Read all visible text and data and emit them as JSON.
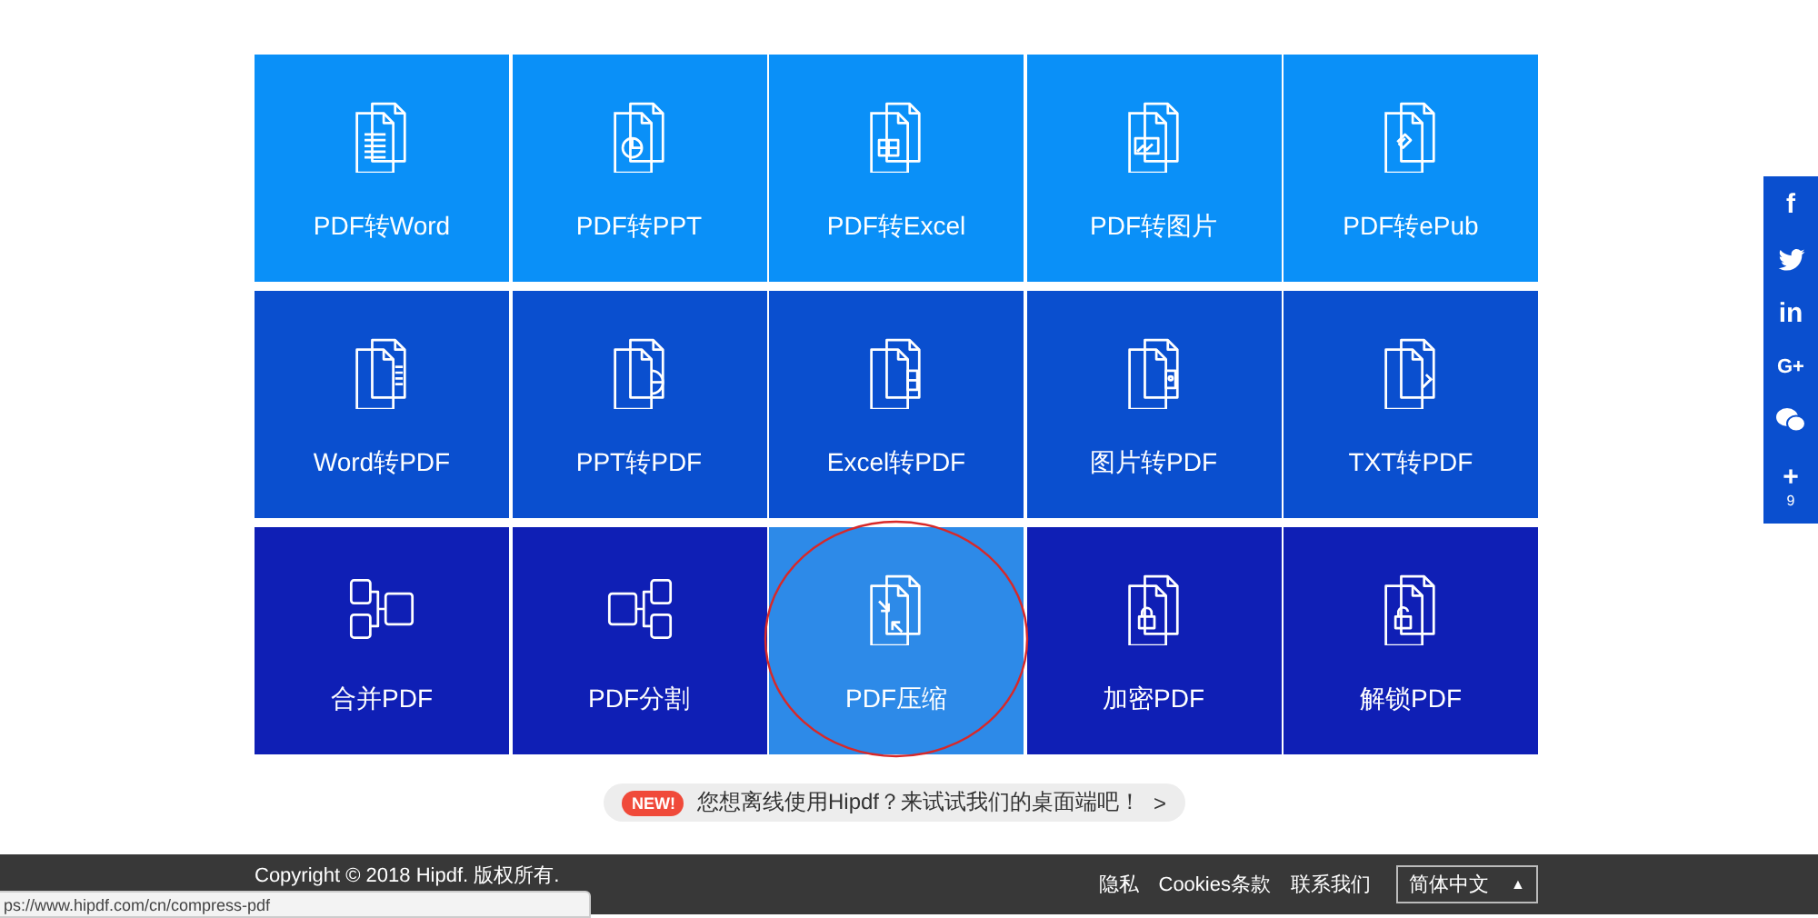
{
  "tools": [
    {
      "label": "PDF转Word",
      "kind": "doc-lines",
      "color": "#0a90f8",
      "circled": false
    },
    {
      "label": "PDF转PPT",
      "kind": "doc-pie",
      "color": "#0a90f8",
      "circled": false
    },
    {
      "label": "PDF转Excel",
      "kind": "doc-grid",
      "color": "#0a90f8",
      "circled": false
    },
    {
      "label": "PDF转图片",
      "kind": "doc-image",
      "color": "#0a90f8",
      "circled": false
    },
    {
      "label": "PDF转ePub",
      "kind": "doc-epub",
      "color": "#0a90f8",
      "circled": false
    },
    {
      "label": "Word转PDF",
      "kind": "to-lines",
      "color": "#0a4fcf",
      "circled": false
    },
    {
      "label": "PPT转PDF",
      "kind": "to-pie",
      "color": "#0a4fcf",
      "circled": false
    },
    {
      "label": "Excel转PDF",
      "kind": "to-grid",
      "color": "#0a4fcf",
      "circled": false
    },
    {
      "label": "图片转PDF",
      "kind": "to-image",
      "color": "#0a4fcf",
      "circled": false
    },
    {
      "label": "TXT转PDF",
      "kind": "to-pen",
      "color": "#0a4fcf",
      "circled": false
    },
    {
      "label": "合并PDF",
      "kind": "merge",
      "color": "#0f1fb5",
      "circled": false
    },
    {
      "label": "PDF分割",
      "kind": "split",
      "color": "#0f1fb5",
      "circled": false
    },
    {
      "label": "PDF压缩",
      "kind": "compress",
      "color": "#2d8ae8",
      "circled": true
    },
    {
      "label": "加密PDF",
      "kind": "lock",
      "color": "#0f1fb5",
      "circled": false
    },
    {
      "label": "解锁PDF",
      "kind": "unlock",
      "color": "#0f1fb5",
      "circled": false
    }
  ],
  "promo": {
    "badge": "NEW!",
    "text": "您想离线使用Hipdf？来试试我们的桌面端吧！",
    "arrow": ">"
  },
  "share": [
    {
      "kind": "text",
      "label": "f"
    },
    {
      "kind": "twitter"
    },
    {
      "kind": "text",
      "label": "in"
    },
    {
      "kind": "text",
      "label": "G+"
    },
    {
      "kind": "wechat"
    },
    {
      "kind": "plus",
      "label": "+",
      "count": "9"
    }
  ],
  "footer": {
    "copyright": "Copyright © 2018 Hipdf. 版权所有.",
    "links": [
      "隐私",
      "Cookies条款",
      "联系我们"
    ],
    "language": "简体中文",
    "language_arrow": "▲"
  },
  "status_bar": "ps://www.hipdf.com/cn/compress-pdf"
}
